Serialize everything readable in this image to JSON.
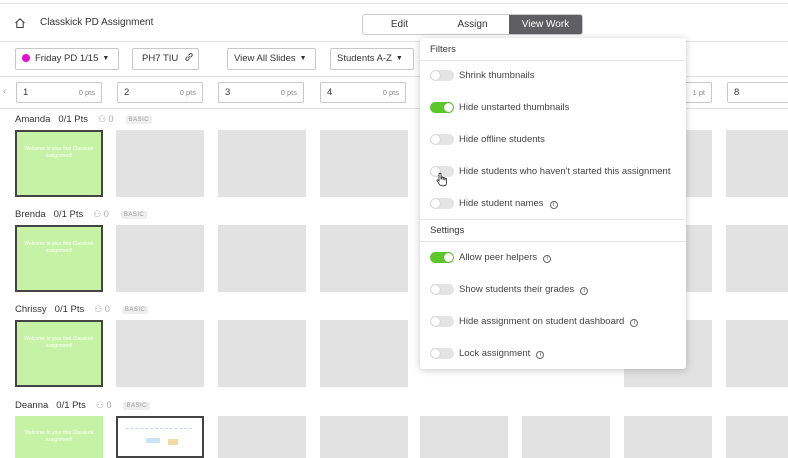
{
  "header": {
    "title": "Classkick PD Assignment",
    "tabs": [
      {
        "label": "Edit",
        "active": false
      },
      {
        "label": "Assign",
        "active": false
      },
      {
        "label": "View Work",
        "active": true
      }
    ]
  },
  "toolbar": {
    "roster": "Friday PD 1/15",
    "roster_color": "#e20fcf",
    "code": "PH7 TIU",
    "slides_filter": "View All Slides",
    "sort": "Students A-Z"
  },
  "slides": [
    {
      "num": "1",
      "pts": "0 pts"
    },
    {
      "num": "2",
      "pts": "0 pts"
    },
    {
      "num": "3",
      "pts": "0 pts"
    },
    {
      "num": "4",
      "pts": "0 pts"
    },
    {
      "num": "",
      "pts": "1 pt"
    },
    {
      "num": "8",
      "pts": ""
    }
  ],
  "students": [
    {
      "name": "Amanda",
      "pts": "0/1 Pts",
      "helpers": "0",
      "badge": "BASIC"
    },
    {
      "name": "Brenda",
      "pts": "0/1 Pts",
      "helpers": "0",
      "badge": "BASIC"
    },
    {
      "name": "Chrissy",
      "pts": "0/1 Pts",
      "helpers": "0",
      "badge": "BASIC"
    },
    {
      "name": "Deanna",
      "pts": "0/1 Pts",
      "helpers": "0",
      "badge": "BASIC"
    }
  ],
  "thumbnail_text": "Welcome to your first Classkick assignment!",
  "panel": {
    "filters_title": "Filters",
    "filters": [
      {
        "label": "Shrink thumbnails",
        "on": false
      },
      {
        "label": "Hide unstarted thumbnails",
        "on": true
      },
      {
        "label": "Hide offline students",
        "on": false
      },
      {
        "label": "Hide students who haven't started this assignment",
        "on": false
      },
      {
        "label": "Hide student names",
        "on": false,
        "info": true
      }
    ],
    "settings_title": "Settings",
    "settings": [
      {
        "label": "Allow peer helpers",
        "on": true,
        "info": true
      },
      {
        "label": "Show students their grades",
        "on": false,
        "info": true
      },
      {
        "label": "Hide assignment on student dashboard",
        "on": false,
        "info": true
      },
      {
        "label": "Lock assignment",
        "on": false,
        "info": true
      }
    ]
  },
  "colors": {
    "toggle_on": "#5dc62c",
    "thumb_done": "#c6f2a6",
    "tab_active": "#5f5f63"
  }
}
